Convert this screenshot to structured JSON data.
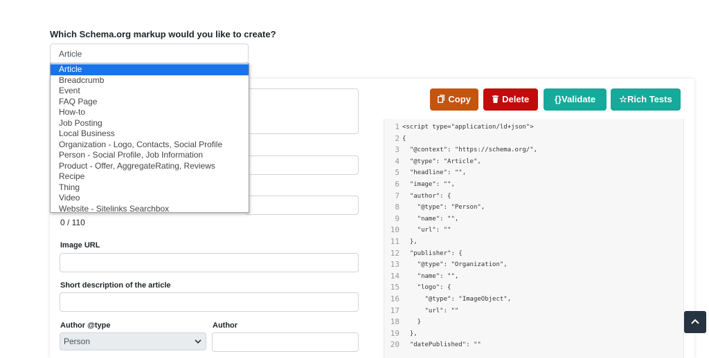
{
  "question": "Which Schema.org markup would you like to create?",
  "schema_select": {
    "selected": "Article"
  },
  "dropdown_options": [
    "Article",
    "Breadcrumb",
    "Event",
    "FAQ Page",
    "How-to",
    "Job Posting",
    "Local Business",
    "Organization - Logo, Contacts, Social Profile",
    "Person - Social Profile, Job Information",
    "Product - Offer, AggregateRating, Reviews",
    "Recipe",
    "Thing",
    "Video",
    "Website - Sitelinks Searchbox"
  ],
  "form": {
    "headline_counter": "0 / 110",
    "image_url_label": "Image URL",
    "short_description_label": "Short description of the article",
    "author_type_label": "Author @type",
    "author_type_value": "Person",
    "author_label": "Author"
  },
  "toolbar": {
    "copy_label": "Copy",
    "delete_label": "Delete",
    "validate_label": "Validate",
    "validate_prefix": "{}",
    "rich_label": "Rich Tests",
    "rich_prefix": "☆"
  },
  "code_lines": [
    {
      "n": "1",
      "t": "<script type=\"application/ld+json\">"
    },
    {
      "n": "2",
      "t": "{"
    },
    {
      "n": "3",
      "t": "  \"@context\": \"https://schema.org/\","
    },
    {
      "n": "4",
      "t": "  \"@type\": \"Article\","
    },
    {
      "n": "5",
      "t": "  \"headline\": \"\","
    },
    {
      "n": "6",
      "t": "  \"image\": \"\","
    },
    {
      "n": "7",
      "t": "  \"author\": {"
    },
    {
      "n": "8",
      "t": "    \"@type\": \"Person\","
    },
    {
      "n": "9",
      "t": "    \"name\": \"\","
    },
    {
      "n": "10",
      "t": "    \"url\": \"\""
    },
    {
      "n": "11",
      "t": "  },"
    },
    {
      "n": "12",
      "t": "  \"publisher\": {"
    },
    {
      "n": "13",
      "t": "    \"@type\": \"Organization\","
    },
    {
      "n": "14",
      "t": "    \"name\": \"\","
    },
    {
      "n": "15",
      "t": "    \"logo\": {"
    },
    {
      "n": "16",
      "t": "      \"@type\": \"ImageObject\","
    },
    {
      "n": "17",
      "t": "      \"url\": \"\""
    },
    {
      "n": "18",
      "t": "    }"
    },
    {
      "n": "19",
      "t": "  },"
    },
    {
      "n": "20",
      "t": "  \"datePublished\": \"\""
    }
  ],
  "colors": {
    "copy": "#c4550f",
    "delete": "#c00c0c",
    "validate": "#17a99a",
    "rich": "#17a99a",
    "selected_option": "#1a73e8",
    "scroll_top": "#263340"
  },
  "icons": {
    "copy": "copy-icon",
    "delete": "trash-icon",
    "scroll_top": "chevron-up-icon"
  }
}
